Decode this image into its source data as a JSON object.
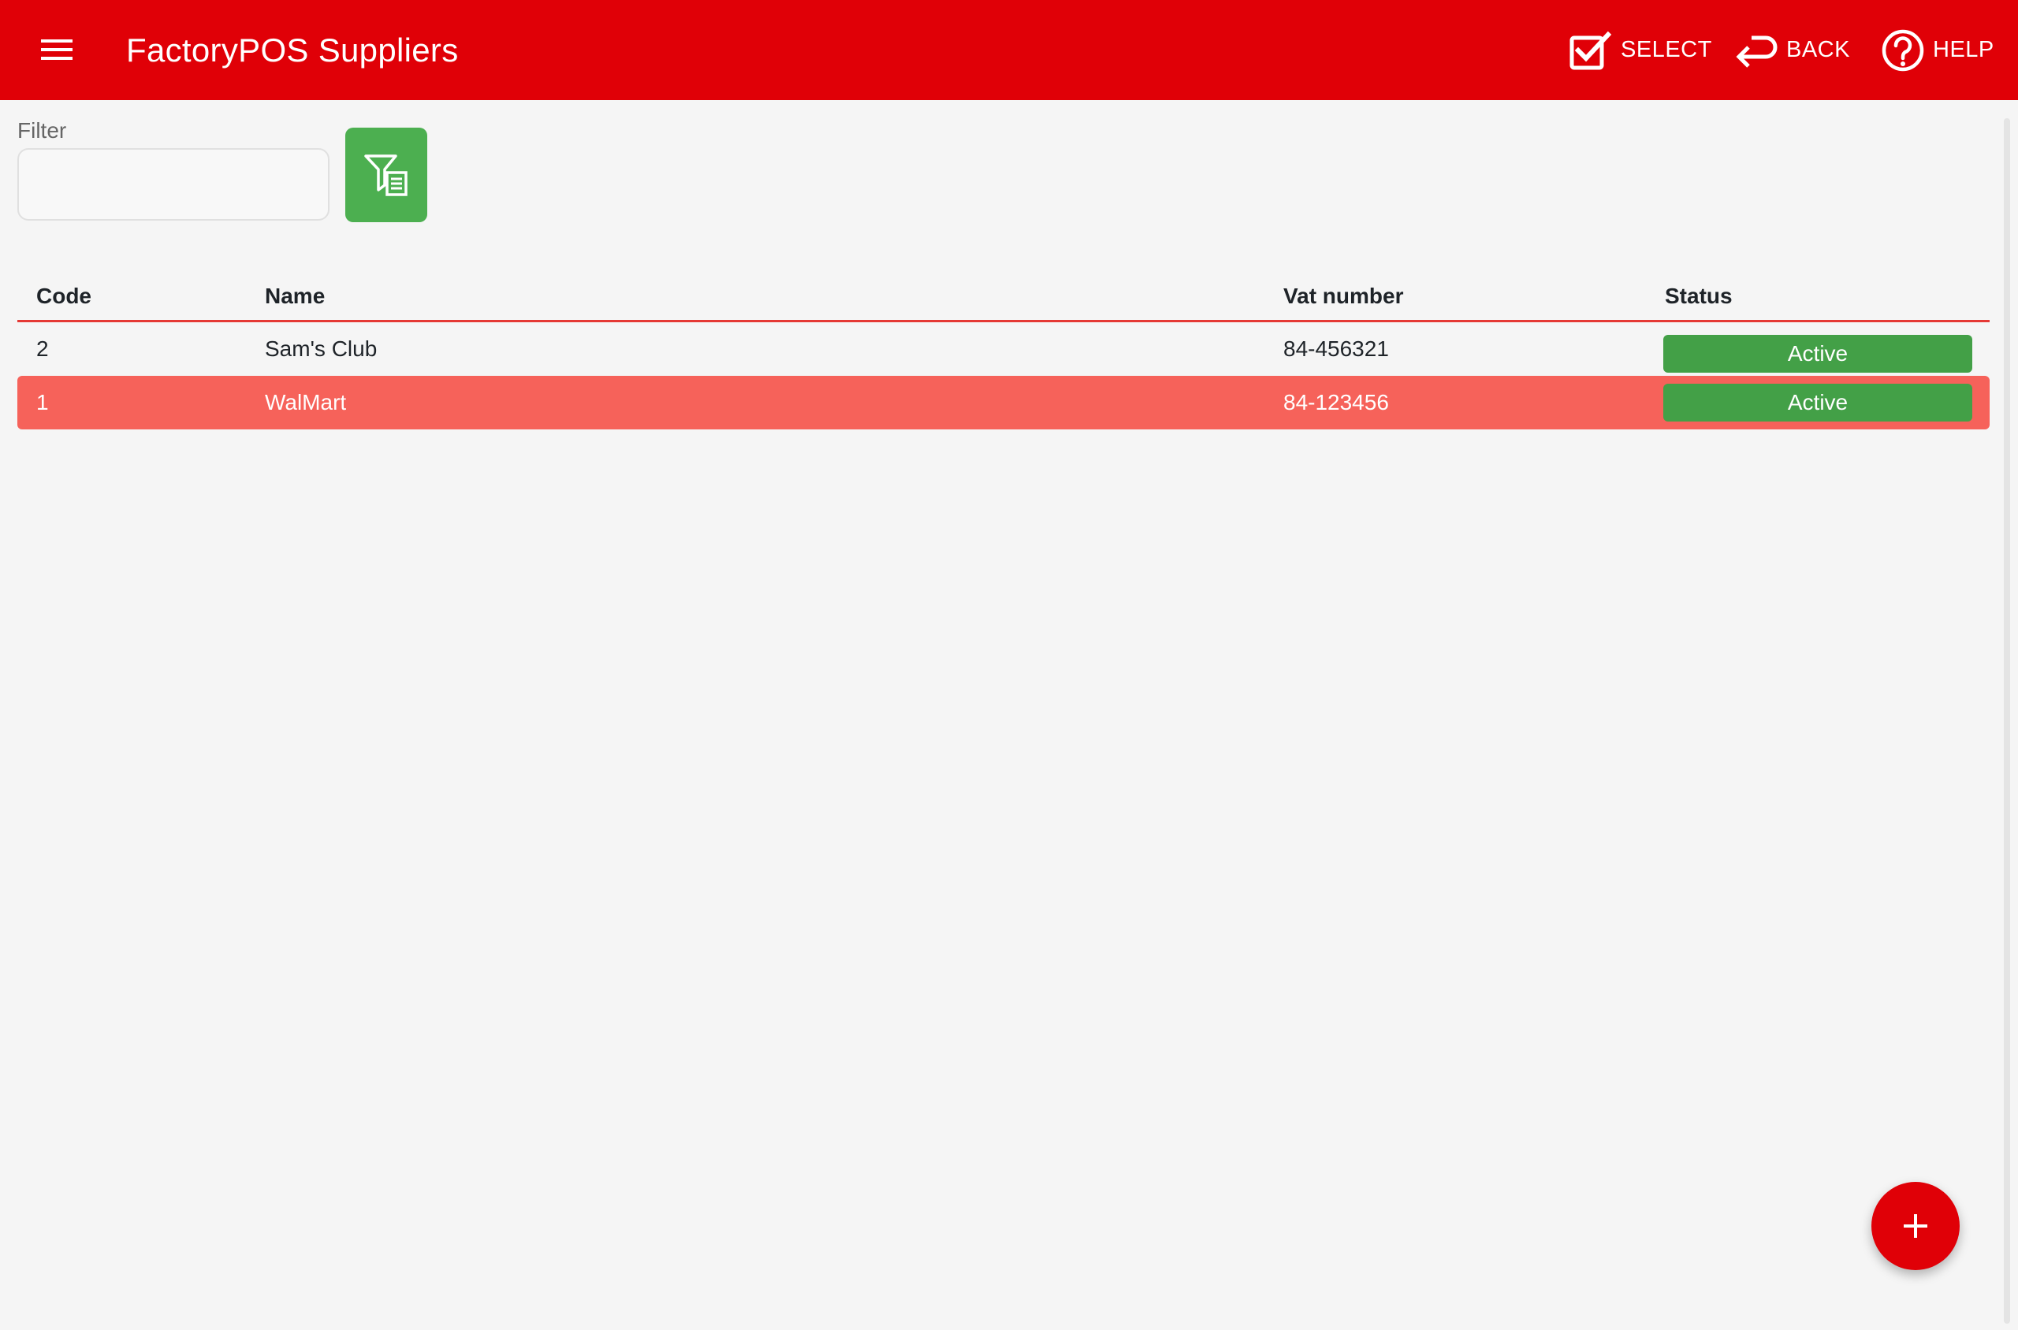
{
  "app": {
    "title": "FactoryPOS Suppliers",
    "accent_color": "#e00007"
  },
  "toolbar": {
    "menu_icon": "hamburger-menu-icon",
    "actions": [
      {
        "label": "SELECT",
        "icon": "checkbox-check-icon"
      },
      {
        "label": "BACK",
        "icon": "return-arrow-icon"
      },
      {
        "label": "HELP",
        "icon": "help-circle-icon"
      }
    ]
  },
  "filter": {
    "label": "Filter",
    "value": "",
    "placeholder": "",
    "button_icon": "filter-list-icon",
    "button_color": "#4caf50"
  },
  "table": {
    "columns": [
      "Code",
      "Name",
      "Vat number",
      "Status"
    ],
    "rows": [
      {
        "code": "2",
        "name": "Sam's Club",
        "vat": "84-456321",
        "status": "Active",
        "selected": false
      },
      {
        "code": "1",
        "name": "WalMart",
        "vat": "84-123456",
        "status": "Active",
        "selected": true
      }
    ],
    "selected_row_color": "#f6625a",
    "status_color": "#43a047"
  },
  "fab": {
    "icon": "plus-icon"
  }
}
